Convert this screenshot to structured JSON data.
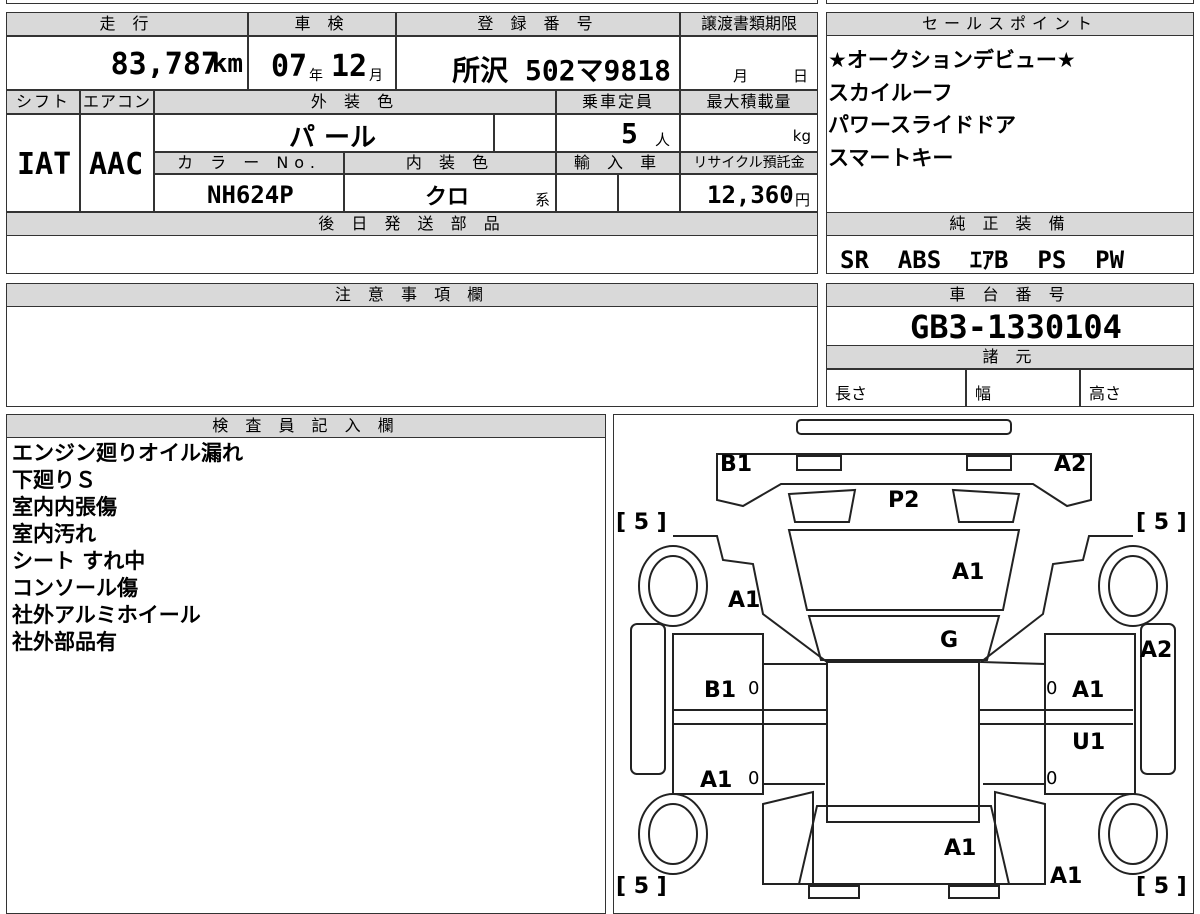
{
  "top": {
    "mileage": {
      "header": "走 行",
      "value": "83,787",
      "unit": "km"
    },
    "inspection": {
      "header": "車 検",
      "year": "07",
      "year_unit": "年",
      "month": "12",
      "month_unit": "月"
    },
    "registration": {
      "header": "登 録 番 号",
      "value": "所沢 502マ9818"
    },
    "transfer": {
      "header": "譲渡書類期限",
      "month_unit": "月",
      "day_unit": "日"
    },
    "shift": {
      "header": "シフト",
      "value": "IAT"
    },
    "aircon": {
      "header": "エアコン",
      "value": "AAC"
    },
    "exterior": {
      "header": "外 装 色",
      "value": "パ ール"
    },
    "capacity": {
      "header": "乗車定員",
      "value": "5",
      "unit": "人"
    },
    "max_load": {
      "header": "最大積載量",
      "unit": "kg"
    },
    "color_no": {
      "header": "カ ラ ー No.",
      "value": "NH624P"
    },
    "interior": {
      "header": "内 装 色",
      "value": "クロ",
      "suffix": "系"
    },
    "import": {
      "header": "輸 入 車"
    },
    "recycle": {
      "header": "リサイクル預託金",
      "value": "12,360",
      "unit": "円"
    },
    "later_parts": {
      "header": "後 日 発 送 部 品"
    }
  },
  "sales_points": {
    "header": "セールスポイント",
    "items": [
      "★オークションデビュー★",
      "スカイルーフ",
      "パワースライドドア",
      "スマートキー"
    ]
  },
  "equipment": {
    "header": "純 正 装 備",
    "value": "SR  ABS  ｴｱB  PS  PW"
  },
  "notes": {
    "header": "注 意 事 項 欄"
  },
  "chassis": {
    "header": "車 台 番 号",
    "value": "GB3-1330104"
  },
  "specs": {
    "header": "諸 元",
    "length": "長さ",
    "width": "幅",
    "height": "高さ"
  },
  "inspector": {
    "header": "検 査 員 記 入 欄",
    "lines": [
      "エンジン廻りオイル漏れ",
      "下廻りＳ",
      "室内内張傷",
      "室内汚れ",
      "シート すれ中",
      "コンソール傷",
      "社外アルミホイール",
      "社外部品有"
    ]
  },
  "diagram": {
    "marks": {
      "b1_top": "B1",
      "a2_top": "A2",
      "p2": "P2",
      "a1_hood": "A1",
      "a1_left_fender": "A1",
      "g": "G",
      "a2_right": "A2",
      "b1_left_door": "B1",
      "a1_right_door": "A1",
      "u1": "U1",
      "a1_left_rear": "A1",
      "a1_roof": "A1",
      "a1_rear_right": "A1"
    },
    "tires": {
      "fl": "[ 5 ]",
      "fr": "[ 5 ]",
      "rl": "[ 5 ]",
      "rr": "[ 5 ]"
    },
    "zeros": [
      "0",
      "0",
      "0",
      "0"
    ]
  }
}
